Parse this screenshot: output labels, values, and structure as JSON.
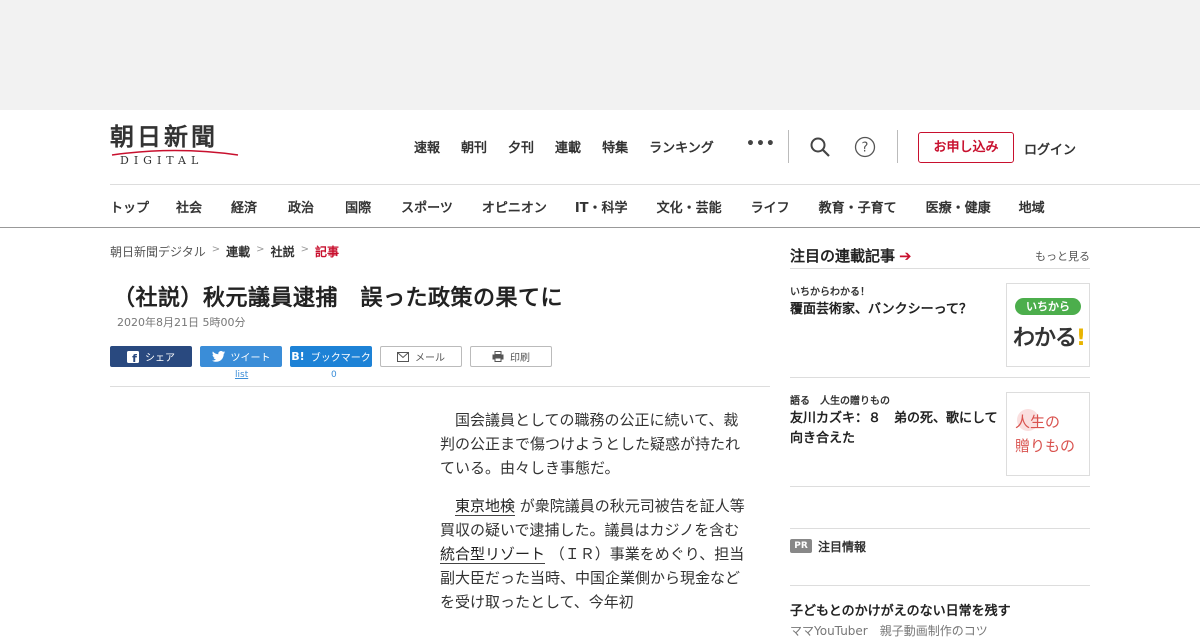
{
  "header": {
    "logo_main": "朝日新聞",
    "logo_sub": "DIGITAL",
    "topnav": [
      "速報",
      "朝刊",
      "夕刊",
      "連載",
      "特集",
      "ランキング"
    ],
    "more": "•••",
    "subscribe": "お申し込み",
    "login": "ログイン"
  },
  "catnav": [
    "トップ",
    "社会",
    "経済",
    "政治",
    "国際",
    "スポーツ",
    "オピニオン",
    "IT・科学",
    "文化・芸能",
    "ライフ",
    "教育・子育て",
    "医療・健康",
    "地域"
  ],
  "breadcrumb": {
    "home": "朝日新聞デジタル",
    "series": "連載",
    "editorial": "社説",
    "current": "記事",
    "sep": ">"
  },
  "article": {
    "title": "（社説）秋元議員逮捕　誤った政策の果てに",
    "date": "2020年8月21日 5時00分",
    "share": {
      "facebook": "シェア",
      "twitter": "ツイート",
      "hatena": "ブックマーク",
      "mail": "メール",
      "print": "印刷",
      "twitter_count": "list",
      "hatena_count": "0"
    },
    "para1": "国会議員としての職務の公正に続いて、裁判の公正まで傷つけようとした疑惑が持たれている。由々しき事態だ。",
    "link1": "東京地検",
    "para2a": "が衆院議員の秋元司被告を証人等買収の疑いで逮捕した。議員はカジノを含む",
    "link2": "統合型リゾート",
    "para2b": "（ＩＲ）事業をめぐり、担当副大臣だった当時、中国企業側から現金などを受け取ったとして、今年初"
  },
  "sidebar": {
    "title": "注目の連載記事",
    "more": "もっと見る",
    "items": [
      {
        "category": "いちからわかる！",
        "headline": "覆面芸術家、バンクシーって？",
        "thumb_text1": "いちから",
        "thumb_text2": "わかる"
      },
      {
        "category": "語る　人生の贈りもの",
        "headline": "友川カズキ：８　弟の死、歌にして向き合えた",
        "thumb_text1": "人生の",
        "thumb_text2": "贈りもの"
      }
    ],
    "pr_badge": "PR",
    "pr_label": "注目情報",
    "pr_headline": "子どもとのかけがえのない日常を残す",
    "pr_sub": "ママYouTuber　親子動画制作のコツ"
  },
  "colors": {
    "brand_red": "#c8102e",
    "facebook": "#29497f",
    "twitter": "#3a8dd8",
    "hatena": "#1d82d6"
  }
}
